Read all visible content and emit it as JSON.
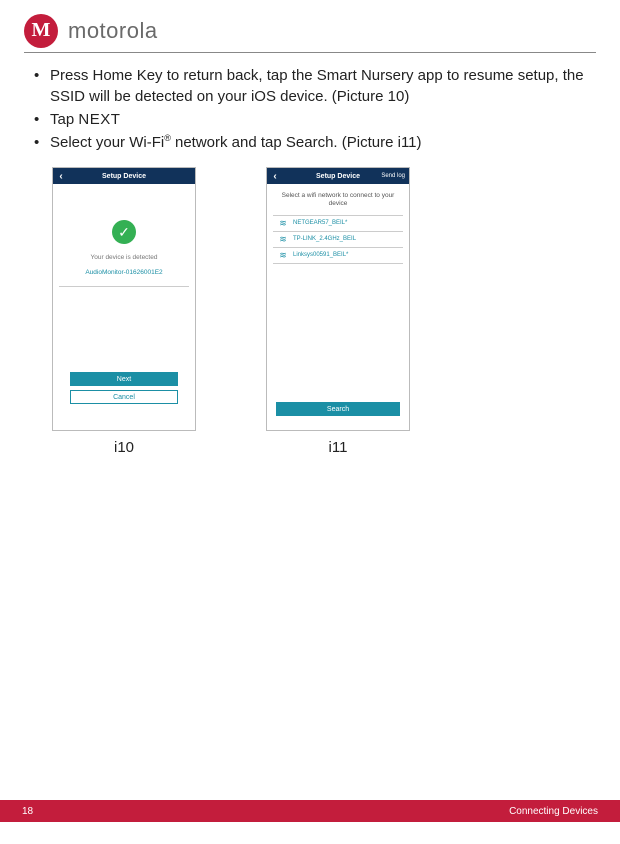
{
  "brand": "motorola",
  "bullets": {
    "b1": "Press Home Key to return back, tap the Smart Nursery app to resume setup, the SSID will be detected on your iOS device. (Picture 10)",
    "b2_prefix": "Tap ",
    "b2_next": "NEXT",
    "b3_prefix": "Select your Wi-Fi",
    "b3_sup": "®",
    "b3_suffix": " network and tap Search. (Picture i11)"
  },
  "phone1": {
    "header_title": "Setup Device",
    "detected": "Your device is detected",
    "device_id": "AudioMonitor-01626001E2",
    "next_btn": "Next",
    "cancel_btn": "Cancel",
    "caption": "i10"
  },
  "phone2": {
    "header_title": "Setup Device",
    "header_action": "Send log",
    "instruction": "Select a wifi network to connect to your device",
    "networks": {
      "n0": "NETGEAR57_BEIL*",
      "n1": "TP-LINK_2.4GHz_BEIL",
      "n2": "Linksys00591_BEIL*"
    },
    "search_btn": "Search",
    "caption": "i11"
  },
  "footer": {
    "page_num": "18",
    "section": "Connecting Devices"
  }
}
